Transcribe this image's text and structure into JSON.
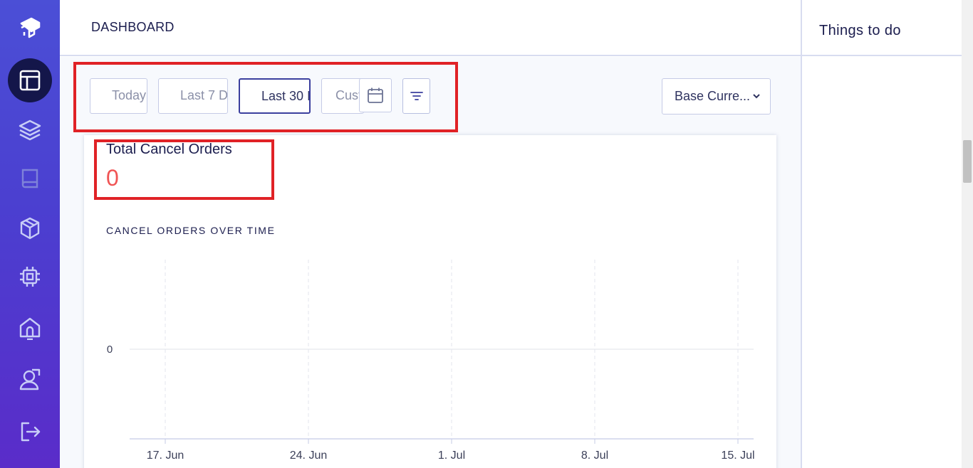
{
  "header": {
    "title": "DASHBOARD"
  },
  "sidebar": {
    "items": [
      {
        "icon": "logo-icon"
      },
      {
        "icon": "dashboard-icon",
        "active": true
      },
      {
        "icon": "layers-icon"
      },
      {
        "icon": "book-icon"
      },
      {
        "icon": "box-icon"
      },
      {
        "icon": "chip-icon"
      },
      {
        "icon": "home-icon"
      },
      {
        "icon": "user-tag-icon"
      },
      {
        "icon": "logout-icon"
      }
    ]
  },
  "filters": {
    "today": "Today",
    "last7": "Last 7 D",
    "last30": "Last 30 I",
    "custom": "Cust",
    "currency": "Base Curre..."
  },
  "stats": {
    "label": "Total Cancel Orders",
    "value": "0"
  },
  "chart_data": {
    "type": "line",
    "title": "CANCEL ORDERS OVER TIME",
    "categories": [
      "17. Jun",
      "24. Jun",
      "1. Jul",
      "8. Jul",
      "15. Jul"
    ],
    "y_ticks": [
      "0"
    ],
    "series": [],
    "grid": true
  },
  "right_panel": {
    "title": "Things to do"
  },
  "colors": {
    "sidebar": "#4b4fd6",
    "accent": "#3b3f9e",
    "value": "#f05454",
    "highlight": "#e02226"
  }
}
